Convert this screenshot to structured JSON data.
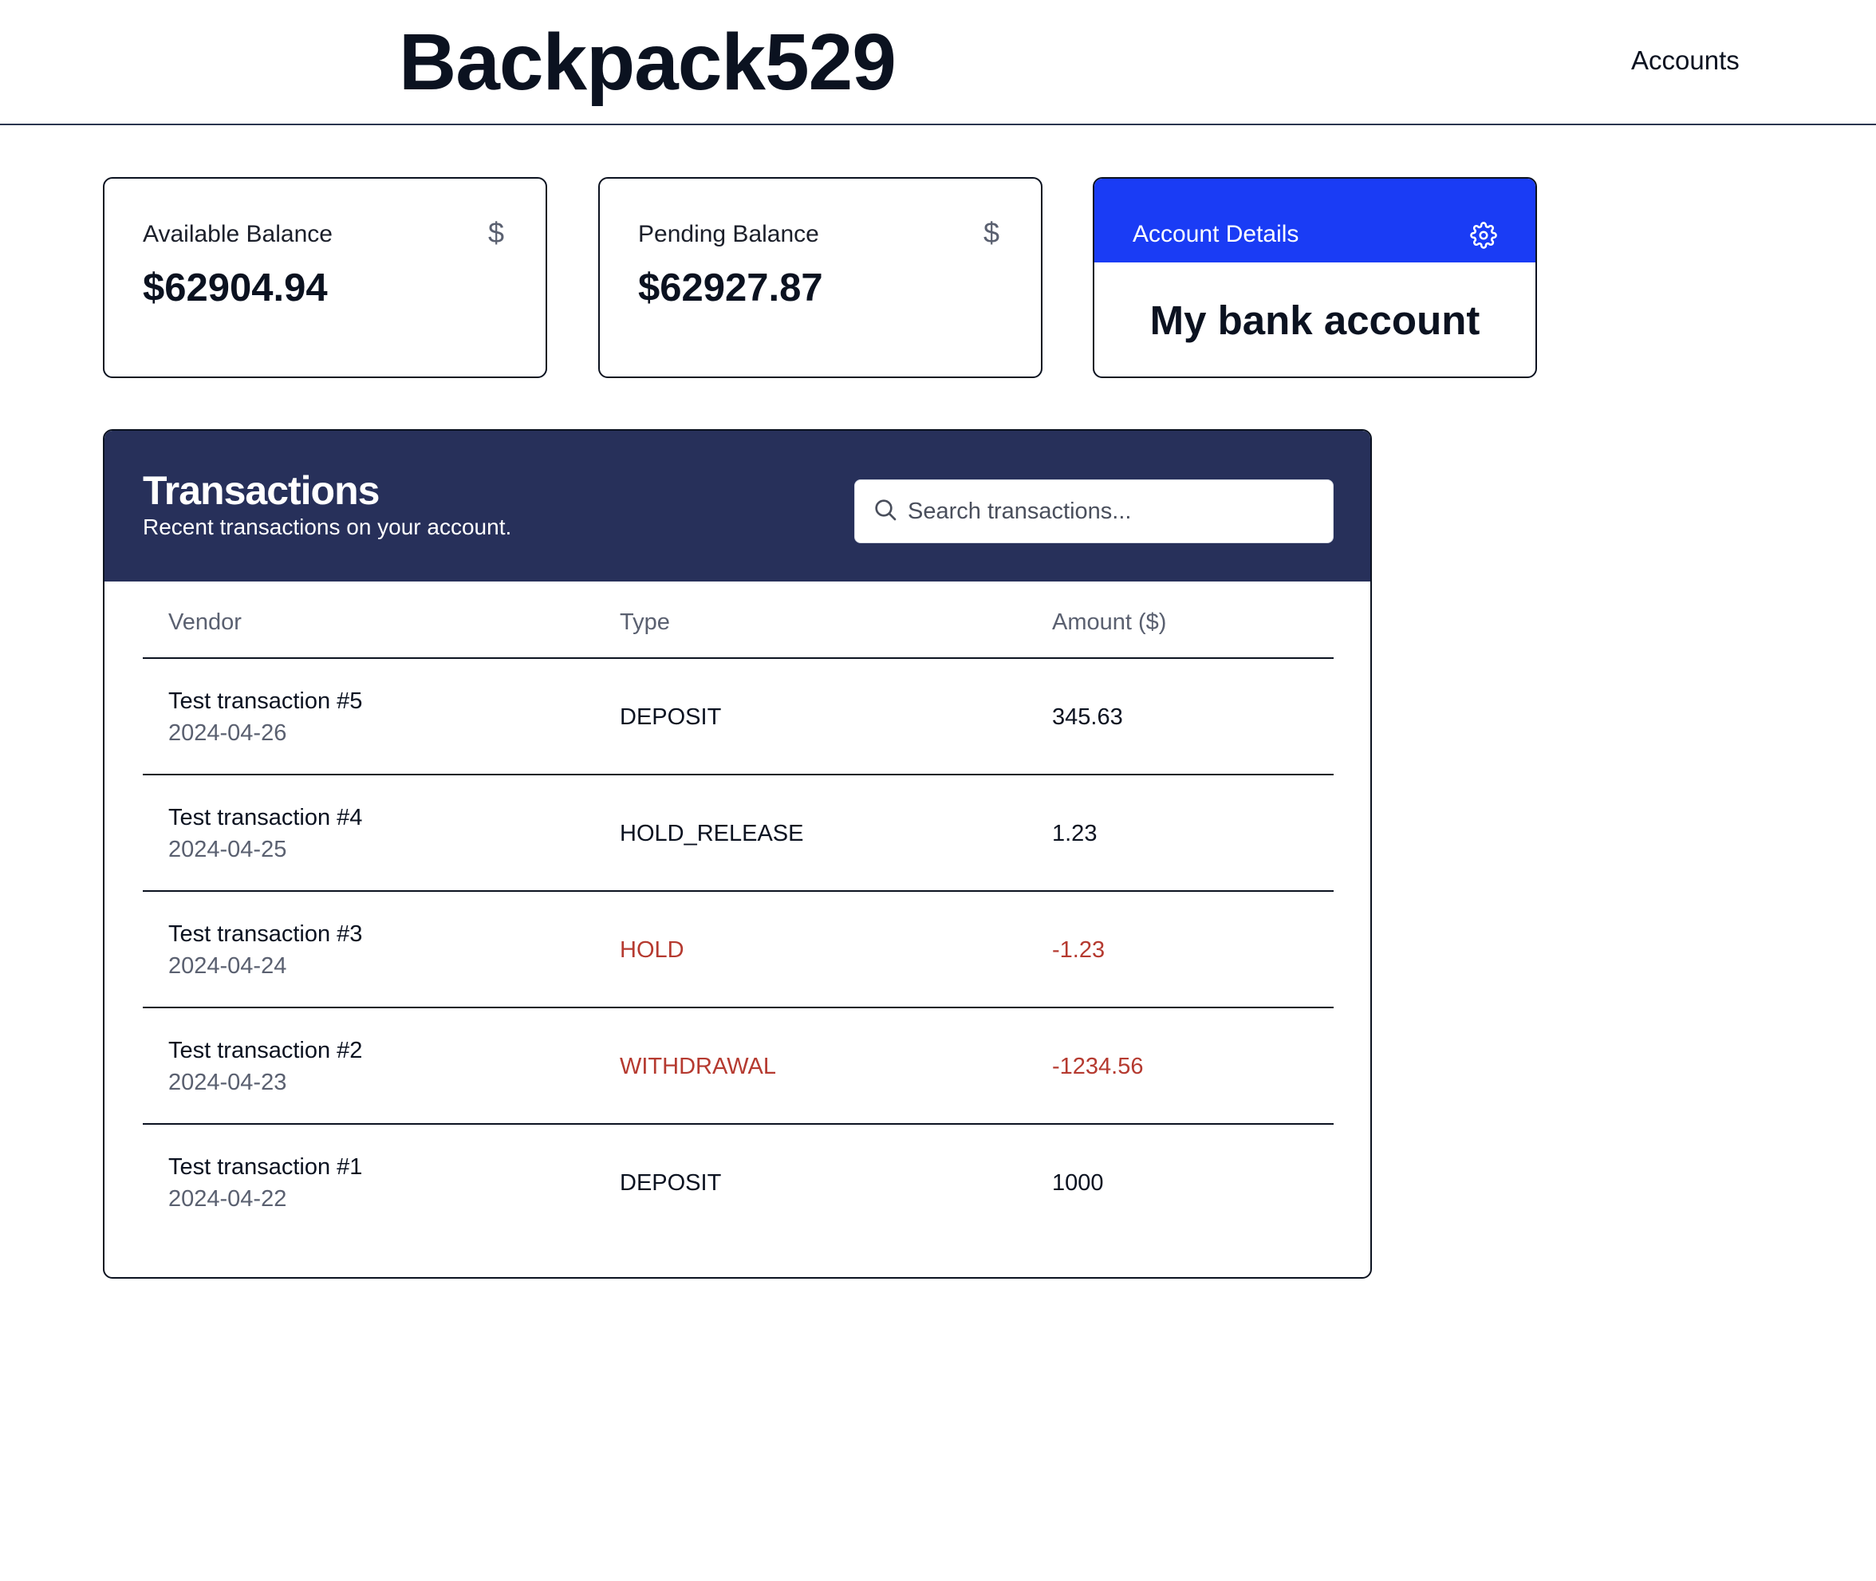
{
  "header": {
    "brand": "Backpack529",
    "nav_accounts": "Accounts"
  },
  "cards": {
    "available": {
      "label": "Available Balance",
      "value": "$62904.94",
      "icon": "dollar-icon"
    },
    "pending": {
      "label": "Pending Balance",
      "value": "$62927.87",
      "icon": "dollar-icon"
    },
    "details": {
      "label": "Account Details",
      "account_name": "My bank account",
      "icon": "gear-icon"
    }
  },
  "colors": {
    "header_panel": "#27305a",
    "accent": "#1a3cf5",
    "negative": "#b53a30"
  },
  "transactions": {
    "title": "Transactions",
    "subtitle": "Recent transactions on your account.",
    "search_placeholder": "Search transactions...",
    "columns": {
      "vendor": "Vendor",
      "type": "Type",
      "amount": "Amount ($)"
    },
    "rows": [
      {
        "vendor": "Test transaction #5",
        "date": "2024-04-26",
        "type": "DEPOSIT",
        "amount": "345.63",
        "negative": false
      },
      {
        "vendor": "Test transaction #4",
        "date": "2024-04-25",
        "type": "HOLD_RELEASE",
        "amount": "1.23",
        "negative": false
      },
      {
        "vendor": "Test transaction #3",
        "date": "2024-04-24",
        "type": "HOLD",
        "amount": "-1.23",
        "negative": true
      },
      {
        "vendor": "Test transaction #2",
        "date": "2024-04-23",
        "type": "WITHDRAWAL",
        "amount": "-1234.56",
        "negative": true
      },
      {
        "vendor": "Test transaction #1",
        "date": "2024-04-22",
        "type": "DEPOSIT",
        "amount": "1000",
        "negative": false
      }
    ]
  }
}
